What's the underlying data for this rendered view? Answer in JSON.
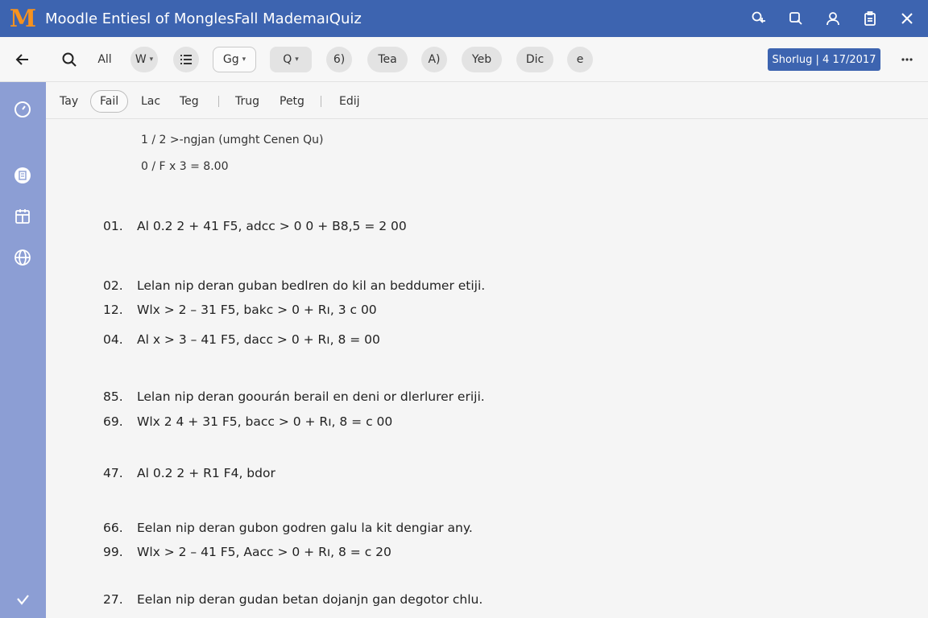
{
  "app": {
    "logo_letter": "M",
    "title": "Moodle Entiesl of MonglesFall MademaıQuiz"
  },
  "toolbar": {
    "items": [
      "All",
      "W",
      "Gg",
      "Q",
      "6)",
      "Tea",
      "A)",
      "Yeb",
      "Dic",
      "e"
    ],
    "primary_button": "Shorlug | 4 17/2017"
  },
  "tabs": [
    "Tay",
    "Fail",
    "Lac",
    "Teg",
    "Trug",
    "Petg",
    "Edij"
  ],
  "header": {
    "line1": "1 / 2 >-ngjan (umght Cenen Qu)",
    "line2": "0 / F x 3 = 8.00"
  },
  "questions": [
    {
      "num": "01.",
      "text": "Al 0.2 2 + 41 F5, adcc > 0 0 + B8,5 = 2 00"
    },
    {
      "num": "02.",
      "text": "Lelan nip deran guban bedlren do kil an beddumer etiji."
    },
    {
      "num": "12.",
      "text": "Wlx > 2 – 31 F5, bakc > 0 + Rı, 3 c 00"
    },
    {
      "num": "04.",
      "text": "Al x > 3 – 41 F5, dacc > 0 + Rı, 8 = 00"
    },
    {
      "num": "85.",
      "text": "Lelan nip deran goourán berail en deni or dlerlurer eriji."
    },
    {
      "num": "69.",
      "text": "Wlx 2 4 + 31 F5, bacc > 0 + Rı, 8 = c 00"
    },
    {
      "num": "47.",
      "text": "Al 0.2 2 + R1 F4, bdor"
    },
    {
      "num": "66.",
      "text": "Eelan nip deran gubon godren galu la kit dengiar any."
    },
    {
      "num": "99.",
      "text": "Wlx > 2 – 41 F5, Aacc > 0 + Rı, 8 = c 20"
    },
    {
      "num": "27.",
      "text": "Eelan nip deran gudan betan dojanjn gan degotor chlu."
    }
  ],
  "colors": {
    "header_bg": "#3d64b0",
    "logo": "#f7921e",
    "sidebar_bg": "#8c9ed4",
    "primary_button": "#3d64b0"
  }
}
